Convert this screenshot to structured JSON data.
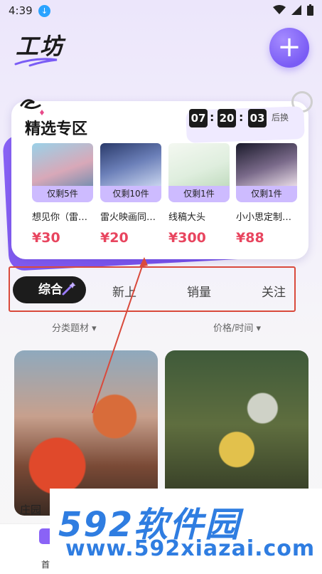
{
  "status_bar": {
    "time": "4:39"
  },
  "header": {
    "title": "工坊",
    "add_symbol": "+"
  },
  "featured": {
    "title": "精选专区",
    "timer": {
      "hours": "07",
      "minutes": "20",
      "seconds": "03",
      "suffix": "后换"
    },
    "products": [
      {
        "stock": "仅剩5件",
        "name": "想见你（雷…",
        "price": "¥30"
      },
      {
        "stock": "仅剩10件",
        "name": "雷火映画同…",
        "price": "¥20"
      },
      {
        "stock": "仅剩1件",
        "name": "线稿大头",
        "price": "¥300"
      },
      {
        "stock": "仅剩1件",
        "name": "小小思定制…",
        "price": "¥88"
      }
    ]
  },
  "tabs": {
    "active": "综合",
    "items": [
      "新上",
      "销量",
      "关注"
    ]
  },
  "filters": {
    "category": "分类题材 ▾",
    "sort": "价格/时间 ▾"
  },
  "feed": {
    "first_caption": "庄园"
  },
  "bottom_nav": {
    "home": "首"
  },
  "watermark": {
    "logo": "592软件园",
    "url": "www.592xiazai.com"
  },
  "colors": {
    "accent": "#7a5cf5",
    "price": "#e8455f",
    "highlight_frame": "#d94a3c",
    "watermark": "#2f7de1"
  }
}
